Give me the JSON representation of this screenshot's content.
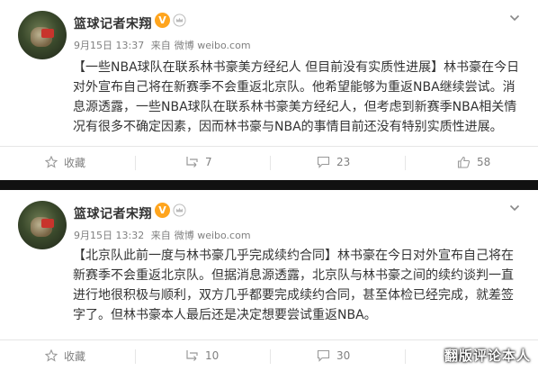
{
  "posts": [
    {
      "author": "篮球记者宋翔",
      "verified_badge": "V",
      "date": "9月15日 13:37",
      "source_prefix": "来自",
      "source": "微博 weibo.com",
      "lines": [
        "【一些NBA球队在联系林书豪美方经纪人 但目前没有实质性进展】林书豪在今日",
        "对外宣布自己将在新赛季不会重返北京队。他希望能够为重返NBA继续尝试。消",
        "息源透露，一些NBA球队在联系林书豪美方经纪人，但考虑到新赛季NBA相关情",
        "况有很多不确定因素，因而林书豪与NBA的事情目前还没有特别实质性进展。"
      ],
      "actions": {
        "favorite": "收藏",
        "repost": "7",
        "comment": "23",
        "like": "58"
      }
    },
    {
      "author": "篮球记者宋翔",
      "verified_badge": "V",
      "date": "9月15日 13:32",
      "source_prefix": "来自",
      "source": "微博 weibo.com",
      "lines": [
        "【北京队此前一度与林书豪几乎完成续约合同】林书豪在今日对外宣布自己将在",
        "新赛季不会重返北京队。但据消息源透露，北京队与林书豪之间的续约谈判一直",
        "进行地很积极与顺利，双方几乎都要完成续约合同，甚至体检已经完成，就差签",
        "字了。但林书豪本人最后还是决定想要尝试重返NBA。"
      ],
      "actions": {
        "favorite": "收藏",
        "repost": "10",
        "comment": "30",
        "like": ""
      }
    }
  ],
  "watermark": "翻版评论本人",
  "colors": {
    "accent": "#ffa51e",
    "text": "#333333",
    "meta": "#808080",
    "separator": "#111111"
  }
}
